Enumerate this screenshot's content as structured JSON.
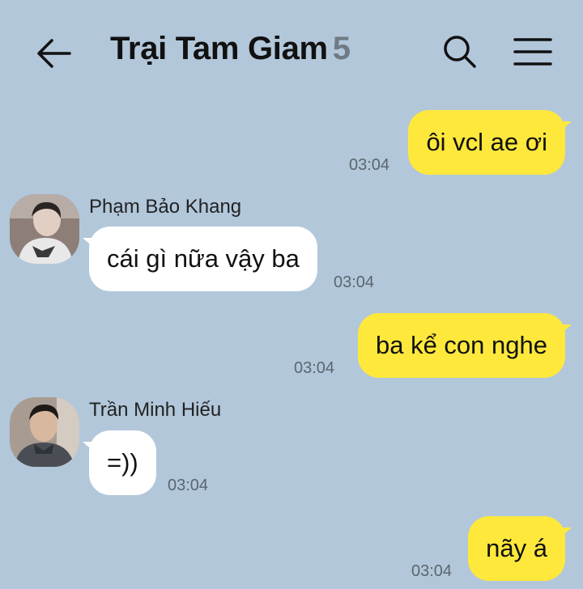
{
  "header": {
    "title": "Trại Tam Giam",
    "member_count": "5",
    "back_icon": "arrow-left-icon",
    "search_icon": "search-icon",
    "menu_icon": "hamburger-menu-icon"
  },
  "messages": [
    {
      "sender": "",
      "text": "ôi vcl ae ơi",
      "time": "03:04",
      "mine": true
    },
    {
      "sender": "Phạm Bảo Khang",
      "text": "cái gì nữa vậy ba",
      "time": "03:04",
      "mine": false
    },
    {
      "sender": "",
      "text": "ba kể con nghe",
      "time": "03:04",
      "mine": true
    },
    {
      "sender": "Trần Minh Hiếu",
      "text": "=))",
      "time": "03:04",
      "mine": false
    },
    {
      "sender": "",
      "text": "nãy á",
      "time": "03:04",
      "mine": true
    }
  ],
  "colors": {
    "background": "#b2c7da",
    "my_bubble": "#fee83c",
    "other_bubble": "#ffffff"
  }
}
